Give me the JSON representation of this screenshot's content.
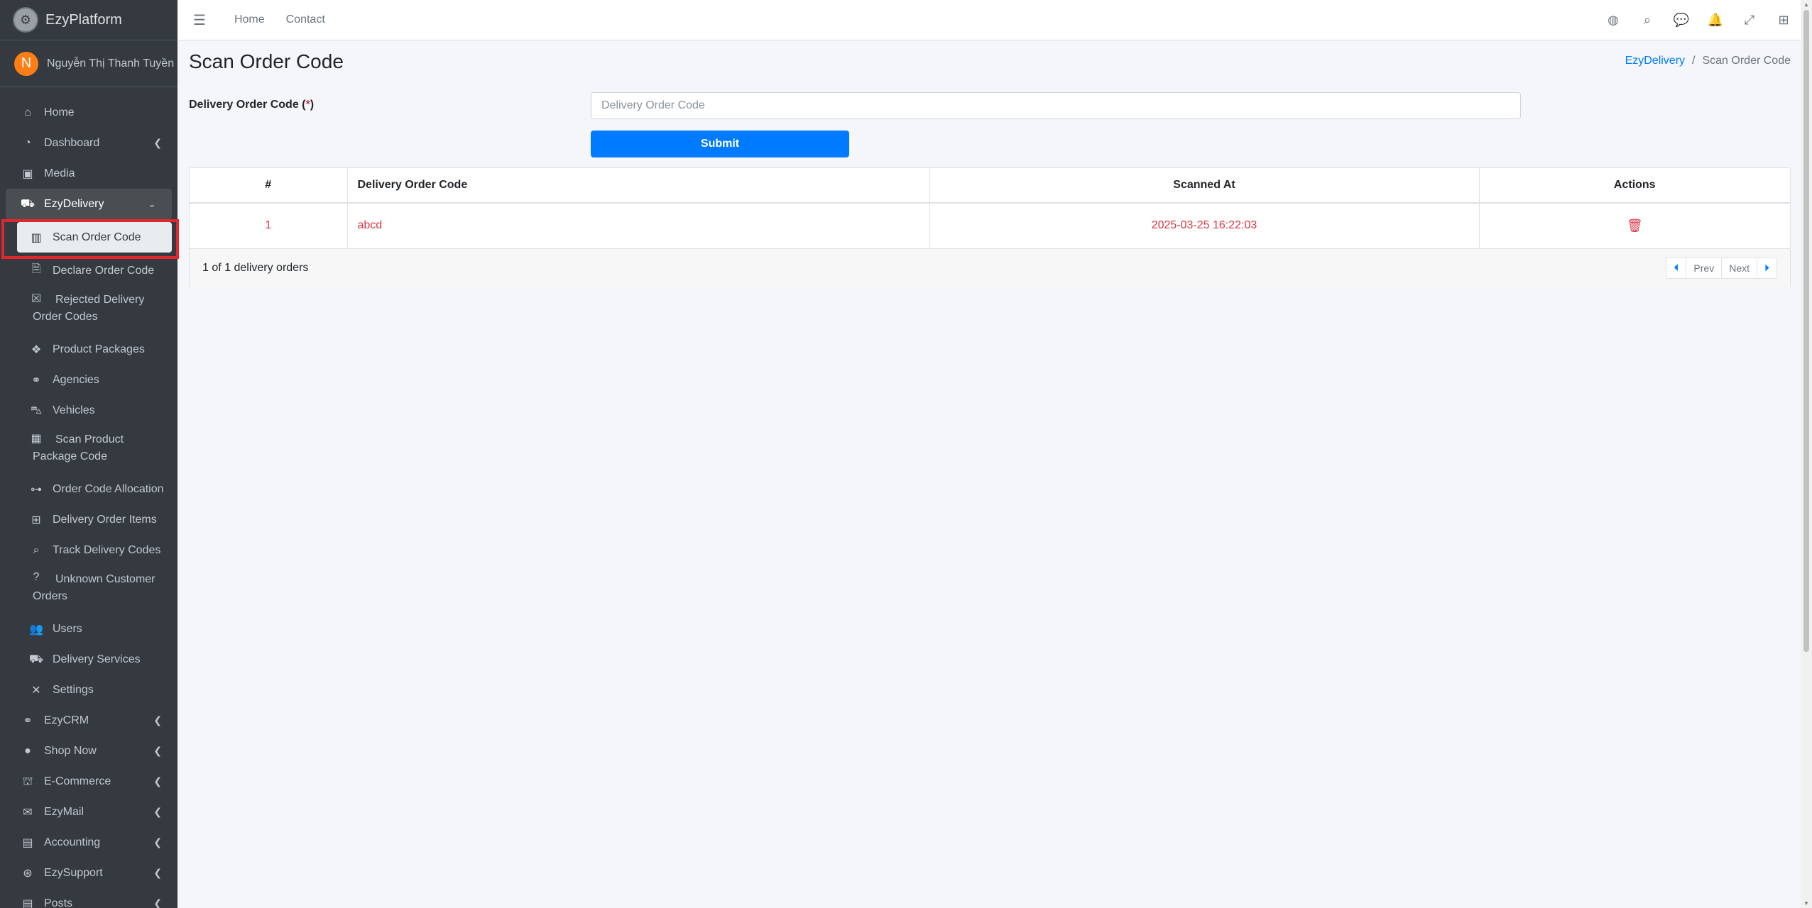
{
  "brand": {
    "name": "EzyPlatform",
    "logo_icon": "ezyplatform-logo-icon"
  },
  "user": {
    "initial": "N",
    "name": "Nguyễn Thị Thanh Tuyền",
    "avatar_color": "#fd7e14"
  },
  "sidebar": {
    "items": [
      {
        "label": "Home",
        "icon": "home-icon"
      },
      {
        "label": "Dashboard",
        "icon": "dashboard-icon"
      },
      {
        "label": "Media",
        "icon": "image-icon"
      },
      {
        "label": "EzyDelivery",
        "icon": "truck-icon"
      },
      {
        "label": "Scan Order Code",
        "icon": "barcode-icon"
      },
      {
        "label": "Declare Order Code",
        "icon": "file-icon"
      },
      {
        "label": "Rejected Delivery Order Codes",
        "icon": "x-square-icon"
      },
      {
        "label": "Product Packages",
        "icon": "boxes-icon"
      },
      {
        "label": "Agencies",
        "icon": "handshake-icon"
      },
      {
        "label": "Vehicles",
        "icon": "car-icon"
      },
      {
        "label": "Scan Product Package Code",
        "icon": "qrcode-icon"
      },
      {
        "label": "Order Code Allocation",
        "icon": "sitemap-icon"
      },
      {
        "label": "Delivery Order Items",
        "icon": "grid-icon"
      },
      {
        "label": "Track Delivery Codes",
        "icon": "search-icon"
      },
      {
        "label": "Unknown Customer Orders",
        "icon": "question-icon"
      },
      {
        "label": "Users",
        "icon": "users-icon"
      },
      {
        "label": "Delivery Services",
        "icon": "truck-icon"
      },
      {
        "label": "Settings",
        "icon": "tools-icon"
      },
      {
        "label": "EzyCRM",
        "icon": "handshake-icon"
      },
      {
        "label": "Shop Now",
        "icon": "circle-icon"
      },
      {
        "label": "E-Commerce",
        "icon": "basket-icon"
      },
      {
        "label": "EzyMail",
        "icon": "envelope-icon"
      },
      {
        "label": "Accounting",
        "icon": "calculator-icon"
      },
      {
        "label": "EzySupport",
        "icon": "lifering-icon"
      },
      {
        "label": "Posts",
        "icon": "newspaper-icon"
      }
    ]
  },
  "topbar": {
    "links": [
      "Home",
      "Contact"
    ],
    "icons": [
      "globe-icon",
      "search-icon",
      "comments-icon",
      "bell-icon",
      "expand-icon",
      "apps-icon"
    ]
  },
  "page": {
    "title": "Scan Order Code",
    "breadcrumb": [
      "EzyDelivery",
      "Scan Order Code"
    ]
  },
  "form": {
    "label": "Delivery Order Code",
    "required_mark": "*",
    "placeholder": "Delivery Order Code",
    "value": "",
    "submit_label": "Submit"
  },
  "table": {
    "columns": [
      "#",
      "Delivery Order Code",
      "Scanned At",
      "Actions"
    ],
    "rows": [
      {
        "num": "1",
        "code": "abcd",
        "scanned_at": "2025-03-25 16:22:03"
      }
    ],
    "summary": "1 of 1 delivery orders",
    "pager": {
      "prev": "Prev",
      "next": "Next"
    }
  },
  "colors": {
    "accent": "#007bff",
    "danger": "#dc3545",
    "sidebar_bg": "#343a40",
    "highlight": "#e3262d"
  }
}
